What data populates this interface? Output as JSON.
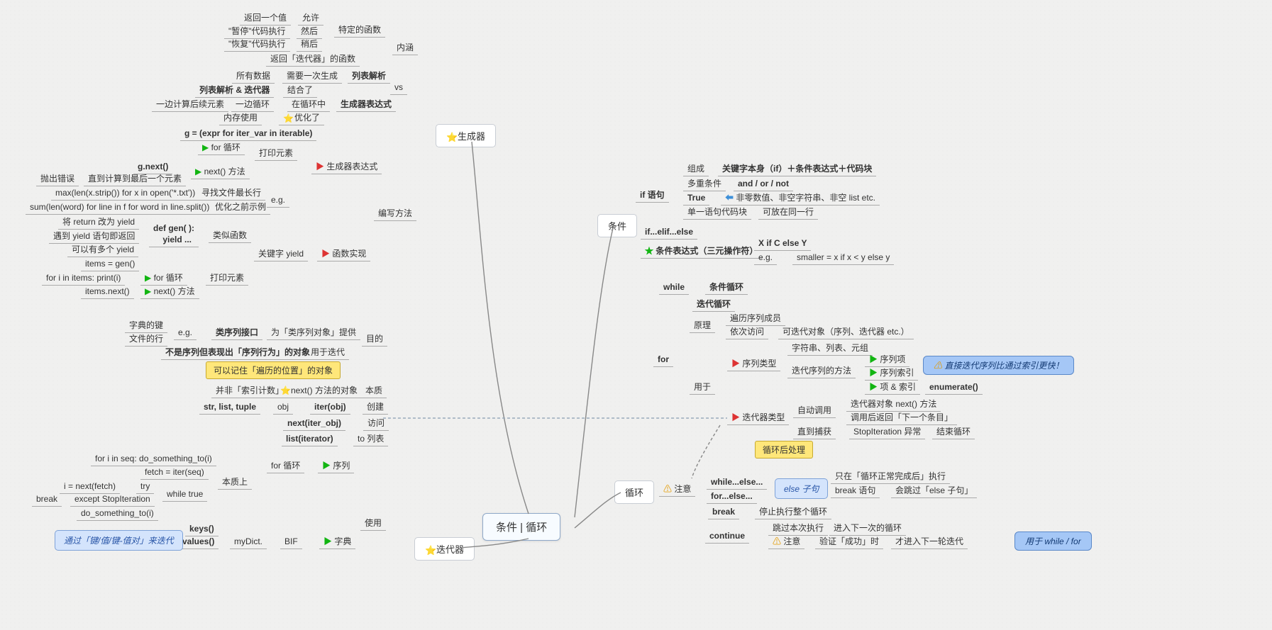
{
  "root": {
    "title": "条件 | 循环"
  },
  "gen": {
    "title": "生成器",
    "inner": "内涵",
    "vs": "vs",
    "write": "编写方法",
    "funcSpec": "特定的函数",
    "retIter": "返回「迭代器」的函数",
    "retVal": "返回一个值",
    "allow": "允许",
    "pause": "\"暂停\"代码执行",
    "then": "然后",
    "resume": "\"恢复\"代码执行",
    "after": "稍后",
    "allData": "所有数据",
    "needOnce": "需要一次生成",
    "listComp": "列表解析",
    "compIter": "列表解析 & 迭代器",
    "combine": "结合了",
    "calcRest": "一边计算后续元素",
    "loopOne": "一边循环",
    "inLoop": "在循环中",
    "genExpr": "生成器表达式",
    "mem": "内存使用",
    "opt": "优化了",
    "gVar": "g = (expr for iter_var in iterable)",
    "forLoop": "for 循环",
    "printEl": "打印元素",
    "genExprLbl": "生成器表达式",
    "gnext": "g.next()",
    "nextM": "next() 方法",
    "throw": "抛出错误",
    "untilLast": "直到计算到最后一个元素",
    "maxlen": "max(len(x.strip()) for x in open('*.txt'))",
    "findLong": "寻找文件最长行",
    "sumlen": "sum(len(word) for line in f for word in line.split())",
    "beforeOpt": "优化之前示例",
    "eg": "e.g.",
    "retYield": "将 return 改为 yield",
    "defgen": "def gen( ):\n    yield ...",
    "likeFunc": "类似函数",
    "meetYield": "遇到 yield 语句即返回",
    "multiYield": "可以有多个 yield",
    "kwYield": "关键字 yield",
    "funcImpl": "函数实现",
    "items": "items = gen()",
    "forI": "for i in items: print(i)",
    "itemsNext": "items.next()"
  },
  "iter": {
    "title": "迭代器",
    "dictKey": "字典的键",
    "fileLine": "文件的行",
    "eg": "e.g.",
    "seqIface": "类序列接口",
    "forSeq": "为「类序列对象」提供",
    "notSeq": "不是序列但表现出「序列行为」的对象",
    "forIter": "用于迭代",
    "purpose": "目的",
    "remember": "可以记住「遍历的位置」的对象",
    "notIdx": "并非「索引计数」",
    "nextObj": "next() 方法的对象",
    "essence": "本质",
    "slt": "str, list, tuple",
    "obj": "obj",
    "iterobj": "iter(obj)",
    "create": "创建",
    "nextit": "next(iter_obj)",
    "visit": "访问",
    "listit": "list(iterator)",
    "tolist": "to 列表",
    "forseq": "for i in seq: do_something_to(i)",
    "forLoop": "for 循环",
    "seq": "序列",
    "fetch": "fetch = iter(seq)",
    "essLbl": "本质上",
    "inext": "i = next(fetch)",
    "try": "try",
    "break": "break",
    "except": "except StopIteration",
    "whiletrue": "while true",
    "dosth": "do_something_to(i)",
    "use": "使用",
    "keys": "keys()",
    "values": "values()",
    "myDict": "myDict.",
    "BIF": "BIF",
    "dict": "字典",
    "tipIter": "通过「键/值/键-值对」来迭代"
  },
  "cond": {
    "title": "条件",
    "ifstmt": "if 语句",
    "compose": "组成",
    "kwCond": "关键字本身（if）＋条件表达式＋代码块",
    "multi": "多重条件",
    "andor": "and / or / not",
    "true": "True",
    "nonzero": "非零数值、非空字符串、非空 list etc.",
    "single": "单一语句代码块",
    "sameLine": "可放在同一行",
    "elif": "if...elif...else",
    "ternary": "条件表达式（三元操作符）",
    "xif": "X if C else Y",
    "egsm": "e.g.",
    "smaller": "smaller = x if x < y else y"
  },
  "loop": {
    "title": "循环",
    "while": "while",
    "condLoop": "条件循环",
    "iterLoop": "迭代循环",
    "for": "for",
    "princ": "原理",
    "traverse": "遍历序列成员",
    "visit": "依次访问",
    "iterObj": "可迭代对象（序列、迭代器 etc.）",
    "usedFor": "用于",
    "seqType": "序列类型",
    "strList": "字符串、列表、元组",
    "iterMethod": "迭代序列的方法",
    "seqItem": "序列项",
    "seqIdx": "序列索引",
    "itemIdx": "项 & 索引",
    "enum": "enumerate()",
    "tipFast": "直接迭代序列比通过索引更快！",
    "iterType": "迭代器类型",
    "autoCall": "自动调用",
    "iterNext": "迭代器对象 next() 方法",
    "afterCall": "调用后返回「下一个条目」",
    "untilCatch": "直到捕获",
    "stopIter": "StopIteration 异常",
    "endLoop": "结束循环",
    "postProc": "循环后处理",
    "note": "注意",
    "whileElse": "while...else...",
    "forElse": "for...else...",
    "elseClause": "else 子句",
    "onlyNormal": "只在「循环正常完成后」执行",
    "breakStmt": "break 语句",
    "skipElse": "会跳过「else 子句」",
    "break": "break",
    "stopAll": "停止执行整个循环",
    "continue": "continue",
    "skipThis": "跳过本次执行",
    "nextIter": "进入下一次的循环",
    "note2": "注意",
    "verify": "验证「成功」时",
    "nextRound": "才进入下一轮迭代",
    "forWhileFor": "用于 while / for"
  }
}
